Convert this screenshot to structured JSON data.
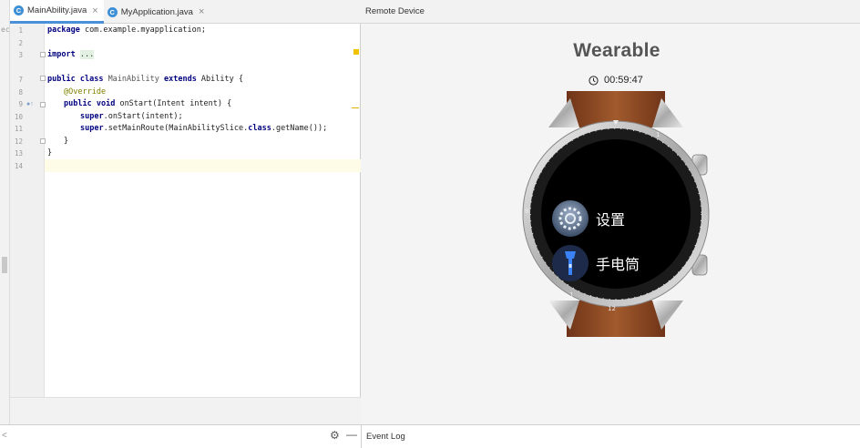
{
  "editor": {
    "left_strip_text": "ec",
    "tabs": [
      {
        "label": "MainAbility.java",
        "icon": "C",
        "active": true
      },
      {
        "label": "MyApplication.java",
        "icon": "C",
        "active": false
      }
    ],
    "line_numbers": [
      "1",
      "2",
      "3",
      "7",
      "8",
      "9",
      "10",
      "11",
      "12",
      "13",
      "14"
    ],
    "code": {
      "l1_kw": "package",
      "l1_rest": " com.example.myapplication;",
      "l3_kw": "import",
      "l3_dots": "...",
      "l7_kw1": "public",
      "l7_kw2": "class",
      "l7_name": "MainAbility",
      "l7_kw3": "extends",
      "l7_rest": " Ability {",
      "l8_ann": "@Override",
      "l9_kw1": "public",
      "l9_kw2": "void",
      "l9_rest": " onStart(Intent intent) {",
      "l10_kw": "super",
      "l10_rest": ".onStart(intent);",
      "l11_kw": "super",
      "l11_rest": ".setMainRoute(MainAbilitySlice.",
      "l11_kw2": "class",
      "l11_rest2": ".getName());",
      "l12": "}",
      "l13": "}"
    }
  },
  "device": {
    "header": "Remote Device",
    "title": "Wearable",
    "timer": "00:59:47",
    "apps": [
      {
        "label": "设置",
        "icon": "gear-icon"
      },
      {
        "label": "手电筒",
        "icon": "flashlight-icon"
      }
    ],
    "bezel_numbers": [
      "8",
      "1",
      "12",
      "1"
    ]
  },
  "bottombar": {
    "left_glyph": "<",
    "event_log": "Event Log"
  },
  "colors": {
    "accent": "#4a90d9",
    "strap": "#8b4a24",
    "keyword": "#000080",
    "annotation": "#808000"
  }
}
